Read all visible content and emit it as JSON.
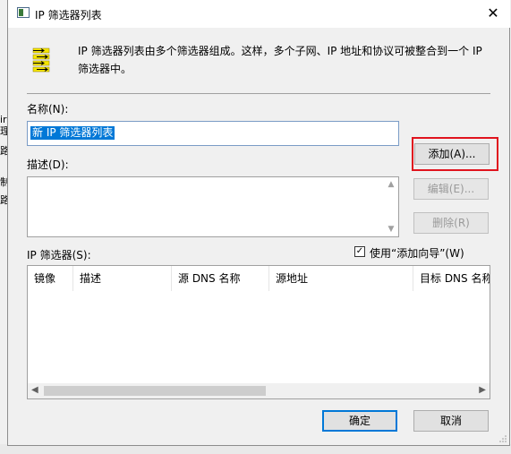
{
  "background": {
    "left_chars": [
      "ir",
      "理",
      "路",
      "制",
      "路"
    ]
  },
  "window": {
    "title": "IP 筛选器列表",
    "close_glyph": "✕"
  },
  "header": {
    "description": "IP 筛选器列表由多个筛选器组成。这样，多个子网、IP 地址和协议可被整合到一个 IP 筛选器中。"
  },
  "form": {
    "name_label": "名称(N):",
    "name_value": "新 IP 筛选器列表",
    "description_label": "描述(D):",
    "description_value": "",
    "filters_label": "IP 筛选器(S):",
    "wizard_checkbox_label": "使用“添加向导”(W)",
    "wizard_checked": true
  },
  "buttons": {
    "add": "添加(A)...",
    "edit": "编辑(E)...",
    "delete": "删除(R)",
    "ok": "确定",
    "cancel": "取消"
  },
  "table": {
    "columns": [
      "镜像",
      "描述",
      "源 DNS 名称",
      "源地址",
      "目标 DNS 名称"
    ],
    "rows": []
  },
  "colors": {
    "highlight_outline": "#e0141e",
    "selection": "#0078d7"
  }
}
